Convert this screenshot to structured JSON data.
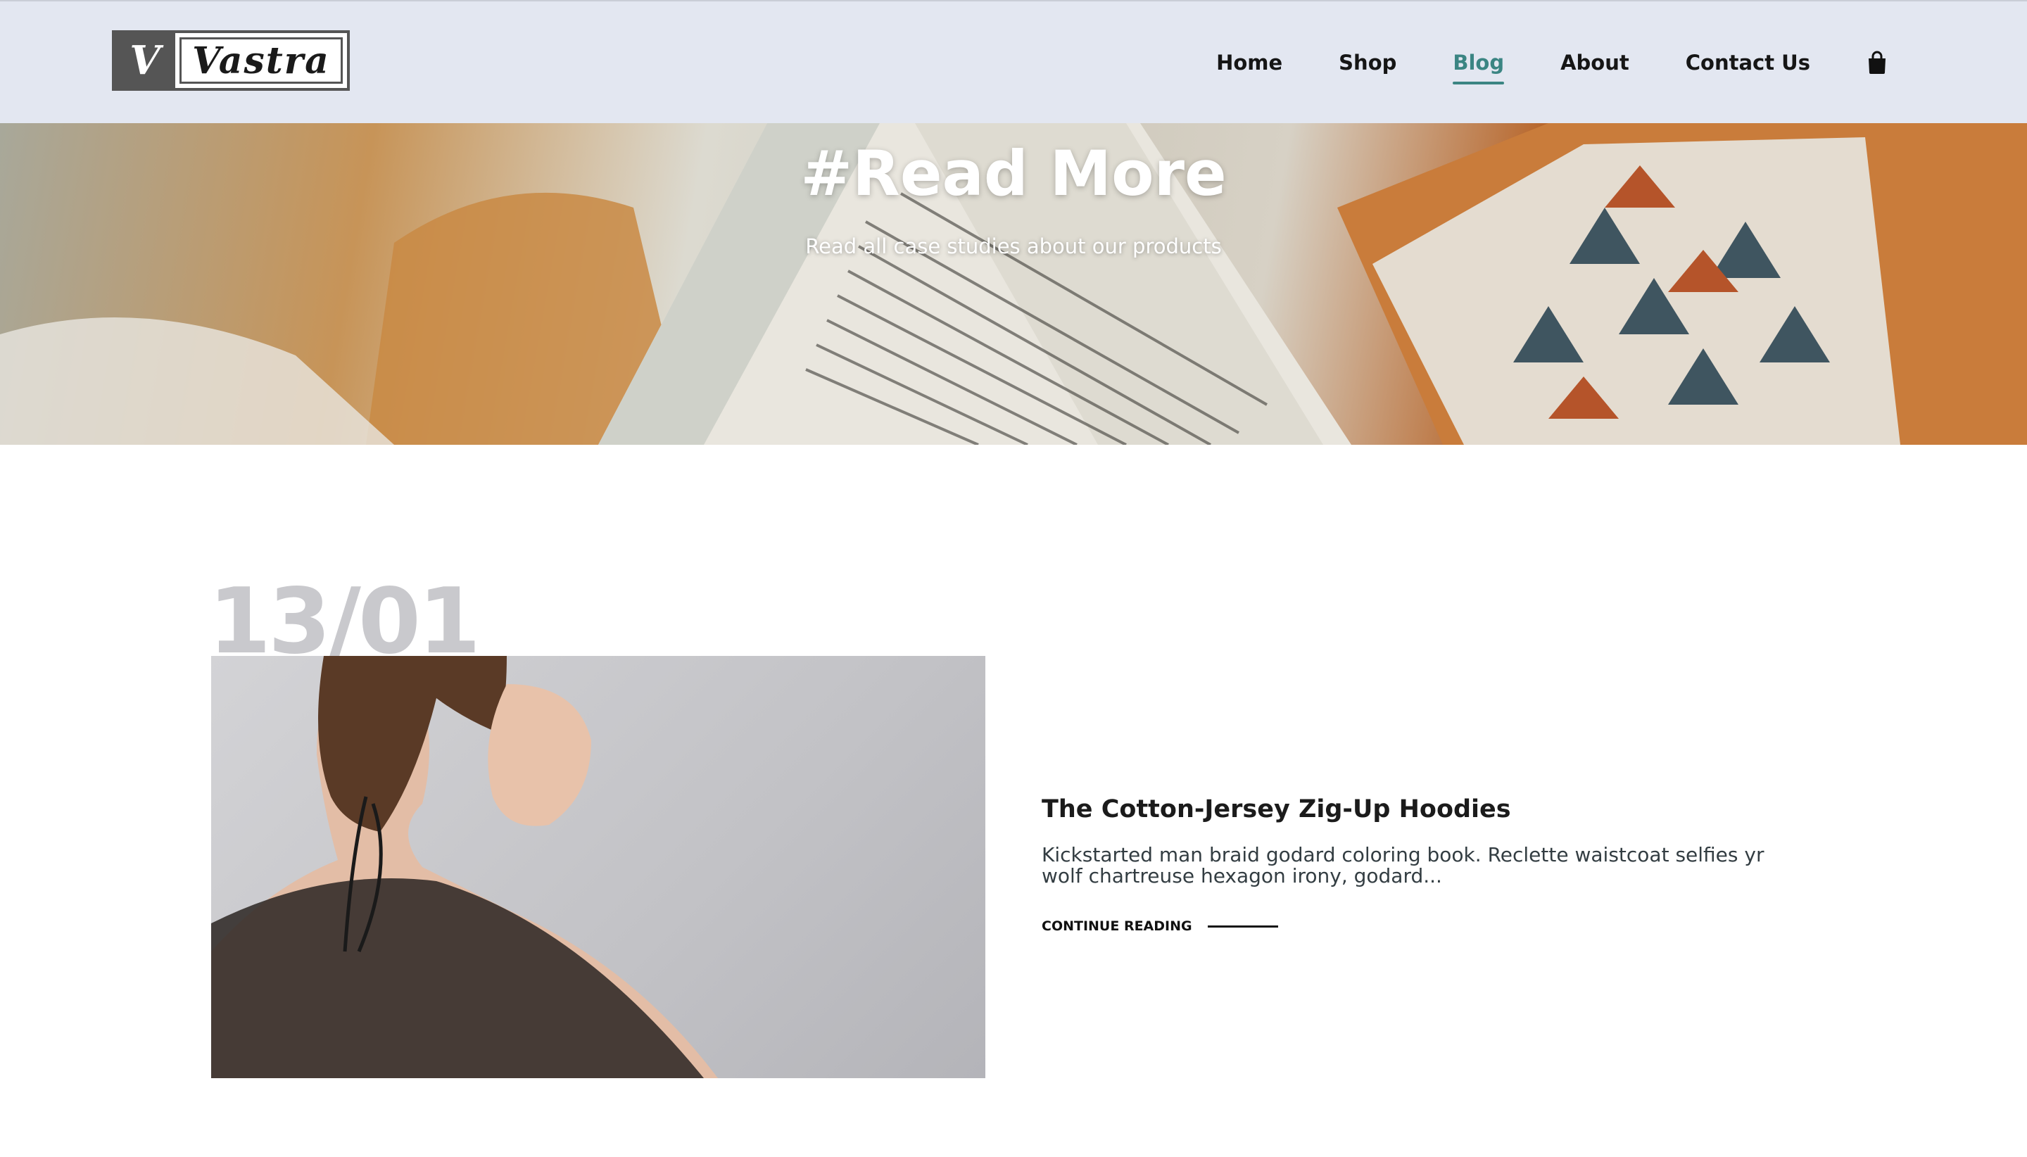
{
  "header": {
    "logo": {
      "mark": "V",
      "word": "Vastra"
    },
    "nav": [
      {
        "label": "Home",
        "active": false
      },
      {
        "label": "Shop",
        "active": false
      },
      {
        "label": "Blog",
        "active": true
      },
      {
        "label": "About",
        "active": false
      },
      {
        "label": "Contact Us",
        "active": false
      }
    ],
    "cart_icon": "shopping-bag-icon",
    "active_color": "#3b8583",
    "background": "#e3e7f1"
  },
  "hero": {
    "title": "#Read More",
    "subtitle": "Read all case studies about our products"
  },
  "posts": [
    {
      "date": "13/01",
      "title": "The Cotton-Jersey Zig-Up Hoodies",
      "excerpt": "Kickstarted man braid godard coloring book. Reclette waistcoat selfies yr wolf chartreuse hexagon irony, godard...",
      "link_label": "CONTINUE READING"
    }
  ]
}
